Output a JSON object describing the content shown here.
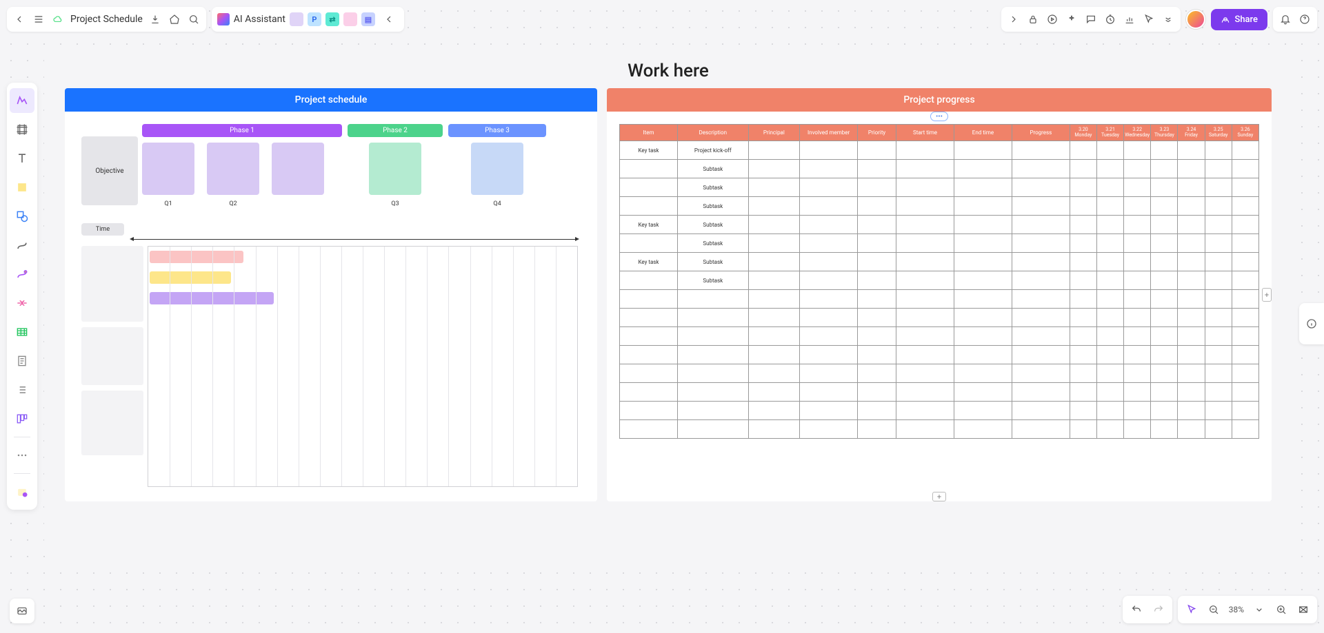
{
  "doc_title": "Project Schedule",
  "ai_label": "AI Assistant",
  "share_label": "Share",
  "zoom": "38%",
  "work_title": "Work here",
  "schedule": {
    "title": "Project schedule",
    "objective": "Objective",
    "time": "Time",
    "phases": [
      "Phase 1",
      "Phase 2",
      "Phase 3"
    ],
    "quarters": [
      "Q1",
      "Q2",
      "Q3",
      "Q4"
    ]
  },
  "progress": {
    "title": "Project  progress",
    "headers": [
      "Item",
      "Description",
      "Principal",
      "Involved member",
      "Priority",
      "Start time",
      "End time",
      "Progress"
    ],
    "dates": [
      {
        "d": "3.20",
        "w": "Monday"
      },
      {
        "d": "3.21",
        "w": "Tuesday"
      },
      {
        "d": "3.22",
        "w": "Wednesday"
      },
      {
        "d": "3.23",
        "w": "Thursday"
      },
      {
        "d": "3.24",
        "w": "Friday"
      },
      {
        "d": "3.25",
        "w": "Saturday"
      },
      {
        "d": "3.26",
        "w": "Sunday"
      }
    ],
    "rows": [
      {
        "item": "Key task",
        "desc": "Project kick-off"
      },
      {
        "item": "",
        "desc": "Subtask"
      },
      {
        "item": "",
        "desc": "Subtask"
      },
      {
        "item": "",
        "desc": "Subtask"
      },
      {
        "item": "Key task",
        "desc": "Subtask"
      },
      {
        "item": "",
        "desc": "Subtask"
      },
      {
        "item": "Key task",
        "desc": "Subtask"
      },
      {
        "item": "",
        "desc": "Subtask"
      },
      {
        "item": "",
        "desc": ""
      },
      {
        "item": "",
        "desc": ""
      },
      {
        "item": "",
        "desc": ""
      },
      {
        "item": "",
        "desc": ""
      },
      {
        "item": "",
        "desc": ""
      },
      {
        "item": "",
        "desc": ""
      },
      {
        "item": "",
        "desc": ""
      },
      {
        "item": "",
        "desc": ""
      }
    ]
  }
}
